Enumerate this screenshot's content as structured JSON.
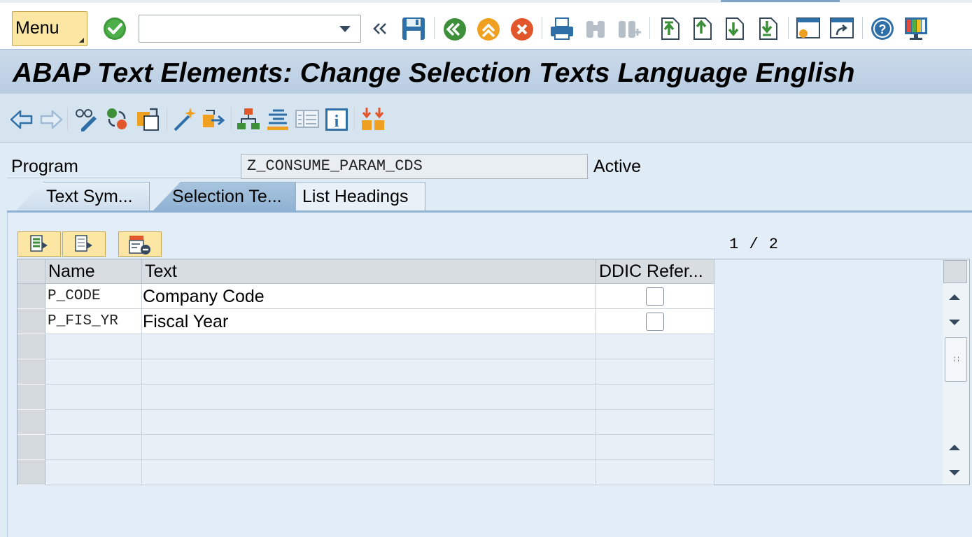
{
  "system_toolbar": {
    "menu_label": "Menu",
    "command_field": {
      "value": "",
      "placeholder": ""
    },
    "icons": [
      "enter-check-icon",
      "expand-history-icon",
      "save-icon",
      "back-icon",
      "exit-icon",
      "cancel-icon",
      "print-icon",
      "find-icon",
      "find-next-icon",
      "first-page-icon",
      "previous-page-icon",
      "next-page-icon",
      "last-page-icon",
      "new-session-icon",
      "shortcut-icon",
      "help-icon",
      "customize-layout-icon"
    ]
  },
  "title": "ABAP Text Elements: Change Selection Texts Language English",
  "app_toolbar": {
    "icons": [
      "back-arrow-icon",
      "forward-arrow-icon",
      "display-change-icon",
      "other-object-icon",
      "copy-object-icon",
      "activate-icon",
      "transport-icon",
      "hierarchy-icon",
      "analyze-icon",
      "list-icon",
      "info-icon",
      "compare-icon"
    ]
  },
  "program": {
    "label": "Program",
    "value": "Z_CONSUME_PARAM_CDS",
    "status": "Active"
  },
  "tabs": [
    {
      "label": "Text Sym...",
      "active": false
    },
    {
      "label": "Selection Te...",
      "active": true
    },
    {
      "label": "List Headings",
      "active": false
    }
  ],
  "table": {
    "page_indicator": "1 / 2",
    "columns": [
      "Name",
      "Text",
      "DDIC Refer..."
    ],
    "rows": [
      {
        "name": "P_CODE",
        "text": "Company Code",
        "ddic": false
      },
      {
        "name": "P_FIS_YR",
        "text": "Fiscal Year",
        "ddic": false
      }
    ]
  },
  "colors": {
    "title_bar": "#c3d5e8",
    "menu_button": "#fbe7a3",
    "active_tab": "#9dbcd9",
    "panel": "#e2edf7"
  }
}
